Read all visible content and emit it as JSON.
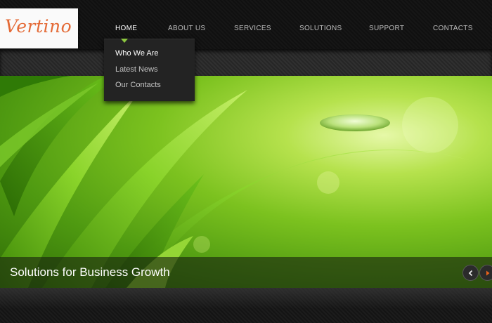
{
  "logo": {
    "text": "Vertino"
  },
  "nav": {
    "items": [
      {
        "label": "HOME",
        "active": true
      },
      {
        "label": "ABOUT US"
      },
      {
        "label": "SERVICES"
      },
      {
        "label": "SOLUTIONS"
      },
      {
        "label": "SUPPORT"
      },
      {
        "label": "CONTACTS"
      }
    ],
    "dropdown": [
      {
        "label": "Who We Are",
        "active": true
      },
      {
        "label": "Latest News"
      },
      {
        "label": "Our Contacts"
      }
    ]
  },
  "slider": {
    "caption": "Solutions for Business Growth",
    "prev_icon": "chevron-left-icon",
    "next_icon": "chevron-right-icon",
    "next_icon_color": "#e8621c"
  },
  "colors": {
    "accent": "#8cc63f",
    "logo": "#e46a36"
  }
}
